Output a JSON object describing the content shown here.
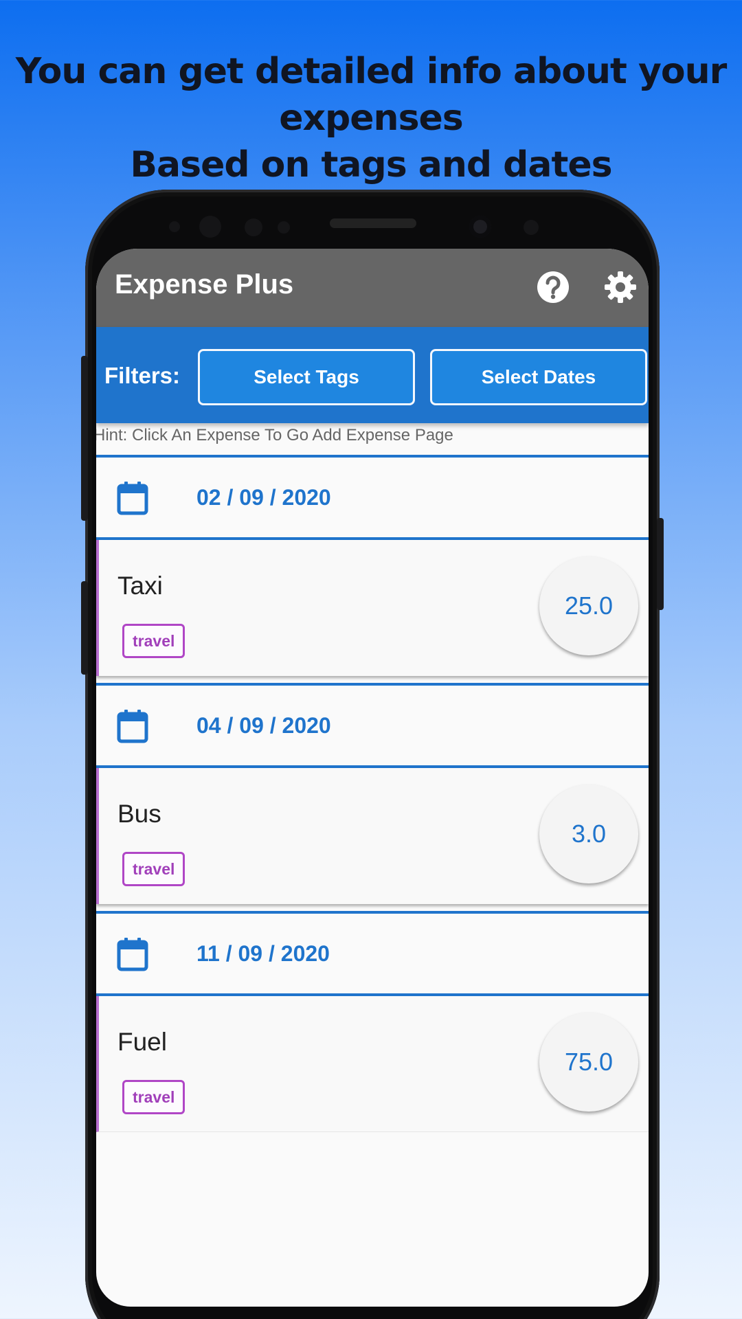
{
  "promo": {
    "line1": "You can get detailed info about your expenses",
    "line2": "Based on tags and dates"
  },
  "app": {
    "title": "Expense Plus",
    "help_icon": "help-circle-icon",
    "settings_icon": "gear-icon"
  },
  "filters": {
    "label": "Filters:",
    "select_tags": "Select Tags",
    "select_dates": "Select Dates"
  },
  "hint": "Hint: Click An Expense To Go Add Expense Page",
  "groups": [
    {
      "date": "02 / 09 / 2020",
      "expense": {
        "name": "Taxi",
        "tag": "travel",
        "amount": "25.0"
      }
    },
    {
      "date": "04 / 09 / 2020",
      "expense": {
        "name": "Bus",
        "tag": "travel",
        "amount": "3.0"
      }
    },
    {
      "date": "11 / 09 / 2020",
      "expense": {
        "name": "Fuel",
        "tag": "travel",
        "amount": "75.0"
      }
    }
  ],
  "colors": {
    "appbar": "#666666",
    "primary": "#1f74cc",
    "tag": "#b046c6"
  }
}
